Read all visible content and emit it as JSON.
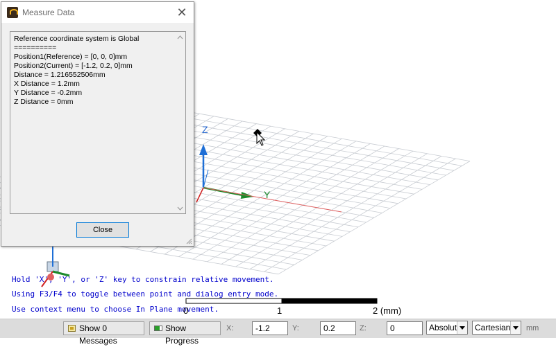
{
  "dialog": {
    "title": "Measure Data",
    "close_label": "Close",
    "lines": [
      "Reference coordinate system is Global",
      "==========",
      "Position1(Reference) = [0, 0, 0]mm",
      "Position2(Current) = [-1.2, 0.2, 0]mm",
      "Distance = 1.216552506mm",
      "X Distance = 1.2mm",
      "Y Distance = -0.2mm",
      "Z Distance = 0mm"
    ]
  },
  "viewport": {
    "axes": {
      "z": "Z",
      "y": "Y"
    },
    "hints": [
      "Hold 'X', 'Y', or 'Z' key to constrain relative movement.",
      "Using F3/F4 to toggle between point and dialog entry mode.",
      "Use context menu to choose In Plane movement."
    ],
    "scale": {
      "start": "0",
      "mid": "1",
      "end": "2 (mm)"
    },
    "colors": {
      "z_axis": "#1e6fd6",
      "y_axis": "#1a8a2a",
      "x_axis": "#d02020",
      "grid": "#c8ccd2",
      "hint_text": "#0000cc"
    }
  },
  "statusbar": {
    "messages_button": "Show 0 Messages",
    "progress_button": "Show Progress",
    "x_label": "X:",
    "x_value": "-1.2",
    "y_label": "Y:",
    "y_value": "0.2",
    "z_label": "Z:",
    "z_value": "0",
    "mode": "Absolut",
    "coord_system": "Cartesian",
    "unit": "mm"
  }
}
